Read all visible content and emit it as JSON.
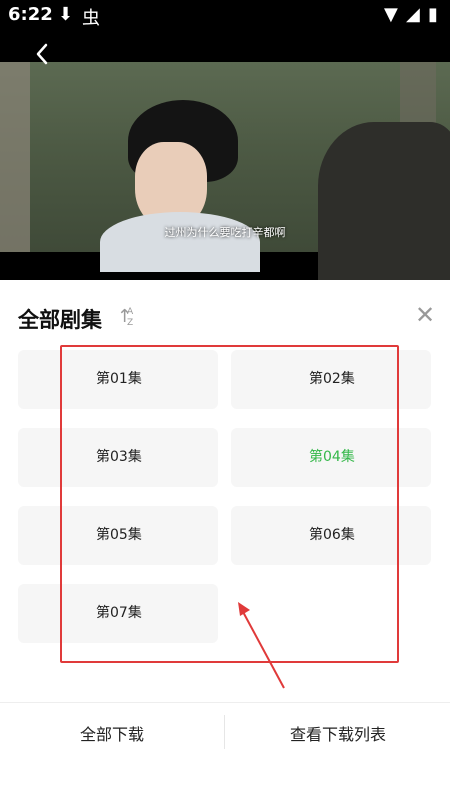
{
  "status_bar": {
    "time": "6:22",
    "icons": [
      "download-icon",
      "bug-icon",
      "wifi-icon",
      "signal-icon",
      "battery-icon"
    ]
  },
  "video": {
    "subtitle": "过州为什么要吃打辛都啊"
  },
  "episodes_panel": {
    "title": "全部剧集",
    "sort_icon": "sort-az-icon",
    "close_icon": "close-icon",
    "episodes": [
      {
        "label": "第01集",
        "active": false
      },
      {
        "label": "第02集",
        "active": false
      },
      {
        "label": "第03集",
        "active": false
      },
      {
        "label": "第04集",
        "active": true
      },
      {
        "label": "第05集",
        "active": false
      },
      {
        "label": "第06集",
        "active": false
      },
      {
        "label": "第07集",
        "active": false
      }
    ]
  },
  "footer": {
    "download_all": "全部下载",
    "view_downloads": "查看下载列表"
  },
  "colors": {
    "active_episode": "#35b84a",
    "annotation_red": "#e03a3a",
    "tile_bg": "#f6f6f6"
  }
}
